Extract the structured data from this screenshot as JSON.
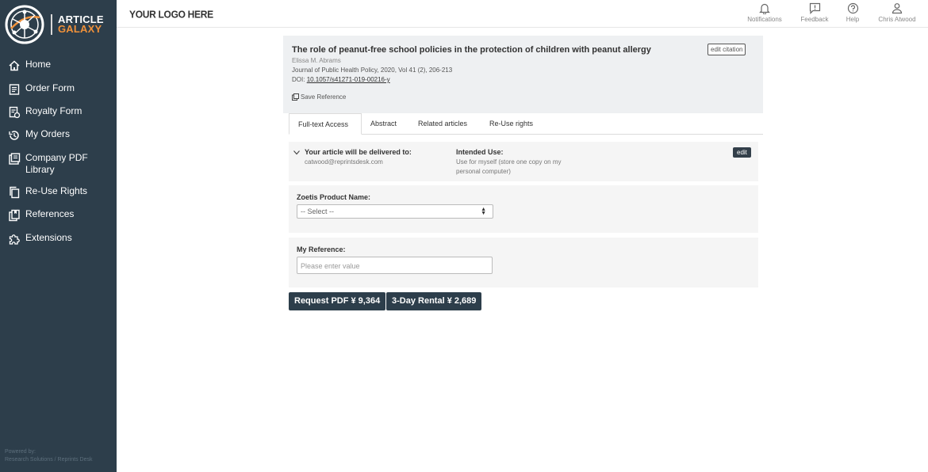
{
  "brand": {
    "line1": "ARTICLE",
    "line2": "GALAXY"
  },
  "nav": [
    {
      "label": "Home",
      "icon": "home-icon"
    },
    {
      "label": "Order Form",
      "icon": "order-form-icon"
    },
    {
      "label": "Royalty Form",
      "icon": "royalty-form-icon"
    },
    {
      "label": "My Orders",
      "icon": "history-icon"
    },
    {
      "label": "Company PDF Library",
      "icon": "library-icon"
    },
    {
      "label": "Re-Use Rights",
      "icon": "copy-icon"
    },
    {
      "label": "References",
      "icon": "references-icon"
    },
    {
      "label": "Extensions",
      "icon": "puzzle-icon"
    }
  ],
  "powered": {
    "line1": "Powered by:",
    "line2": "Research Solutions / Reprints Desk"
  },
  "topbar": {
    "logo_text": "YOUR LOGO HERE",
    "notifications": "Notifications",
    "feedback": "Feedback",
    "help": "Help",
    "user": "Chris Atwood"
  },
  "citation": {
    "title": "The role of peanut-free school policies in the protection of children with peanut allergy",
    "author": "Elissa M. Abrams",
    "journal": "Journal of Public Health Policy, 2020, Vol 41 (2), 206-213",
    "doi_label": "DOI:",
    "doi": "10.1057/s41271-019-00216-y",
    "edit_label": "edit citation",
    "save_label": "Save Reference"
  },
  "tabs": [
    "Full-text Access",
    "Abstract",
    "Related articles",
    "Re-Use rights"
  ],
  "delivery": {
    "label": "Your article will be delivered to:",
    "email": "catwood@reprintsdesk.com",
    "use_label": "Intended Use:",
    "use_line1": "Use for myself (store one copy on my",
    "use_line2": "personal computer)",
    "edit_label": "edit"
  },
  "product": {
    "label": "Zoetis Product Name:",
    "selected": "-- Select --"
  },
  "reference": {
    "label": "My Reference:",
    "placeholder": "Please enter value"
  },
  "actions": {
    "request_pdf": "Request PDF ¥ 9,364",
    "rental": "3-Day Rental ¥ 2,689"
  },
  "colors": {
    "sidebar": "#2d3e4b",
    "accent": "#f0913a"
  }
}
